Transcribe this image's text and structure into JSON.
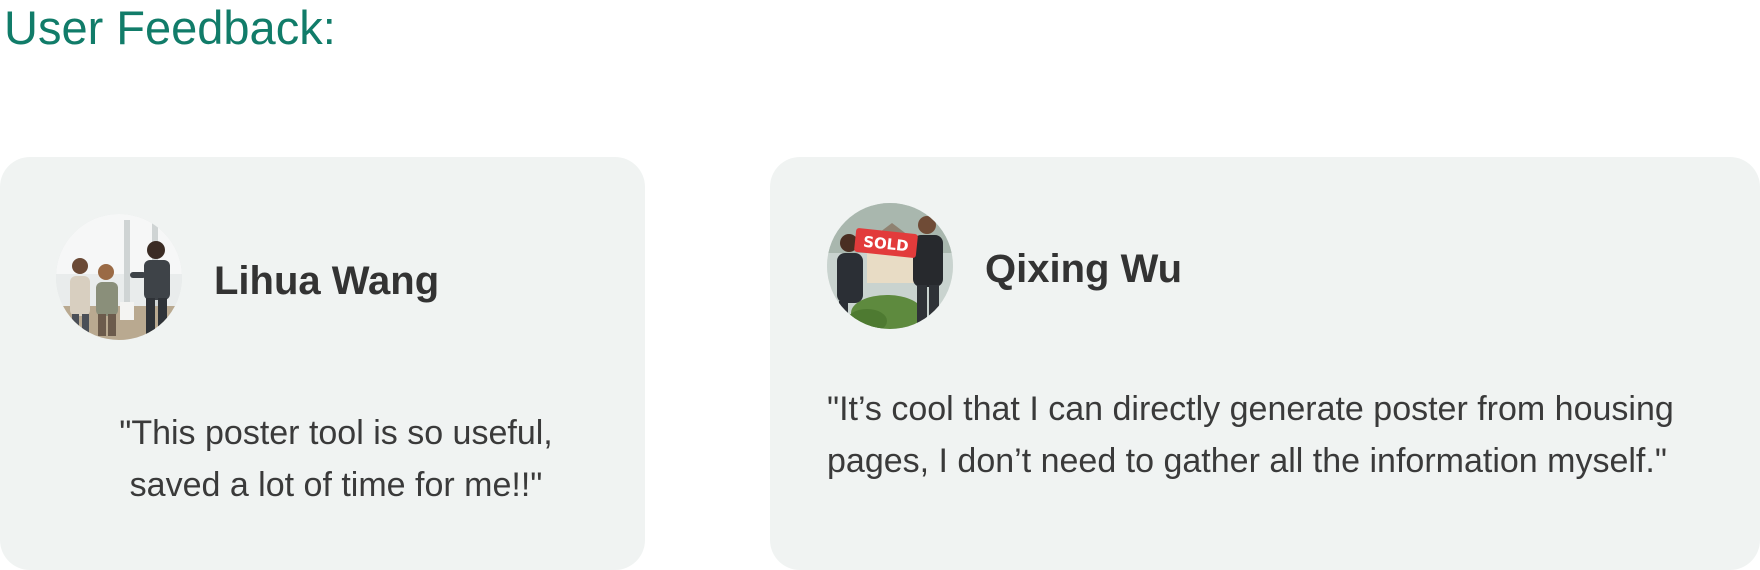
{
  "colors": {
    "title": "#117c69",
    "card_background": "#f0f3f2",
    "name": "#333333",
    "quote": "#3a3a3a"
  },
  "section": {
    "title": "User Feedback:"
  },
  "testimonials": [
    {
      "name": "Lihua Wang",
      "avatar_icon": "avatar-photo-people-in-office",
      "quote": "\"This poster tool is so useful,\n saved a lot of time for me!!\""
    },
    {
      "name": "Qixing Wu",
      "avatar_icon": "avatar-photo-couple-with-sold-sign",
      "sign_text": "SOLD",
      "quote": " \"It’s cool that I can directly generate poster from housing pages, I don’t need to gather all the information myself.\""
    }
  ]
}
